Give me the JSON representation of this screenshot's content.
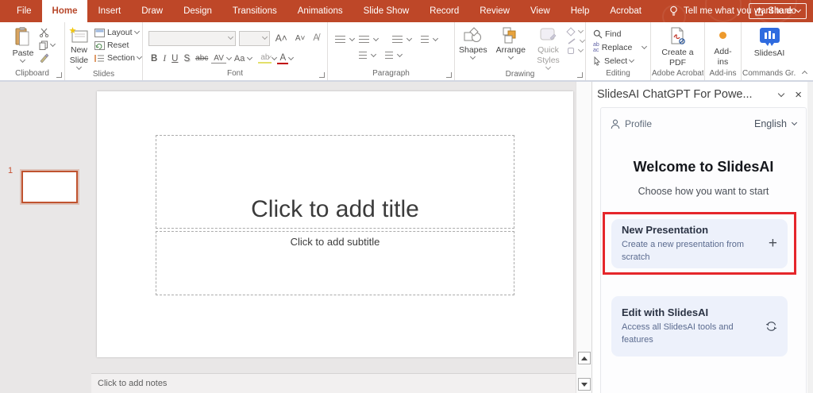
{
  "titlebar": {
    "tabs": [
      "File",
      "Home",
      "Insert",
      "Draw",
      "Design",
      "Transitions",
      "Animations",
      "Slide Show",
      "Record",
      "Review",
      "View",
      "Help",
      "Acrobat"
    ],
    "active_tab": "Home",
    "tell_me": "Tell me what you want to do",
    "share": "Share"
  },
  "ribbon": {
    "paste": "Paste",
    "new_slide": "New Slide",
    "layout": "Layout",
    "reset": "Reset",
    "section": "Section",
    "font_buttons": {
      "bold": "B",
      "italic": "I",
      "underline": "U",
      "shadow": "S",
      "strike": "abc",
      "spacing": "AV",
      "case": "Aa",
      "color": "A"
    },
    "shapes": "Shapes",
    "arrange": "Arrange",
    "quick_styles": "Quick Styles",
    "find": "Find",
    "replace": "Replace",
    "select": "Select",
    "create_pdf": "Create a PDF",
    "addins": "Add-ins",
    "slidesai": "SlidesAI",
    "group_labels": {
      "clipboard": "Clipboard",
      "slides": "Slides",
      "font": "Font",
      "paragraph": "Paragraph",
      "drawing": "Drawing",
      "editing": "Editing",
      "acrobat": "Adobe Acrobat",
      "addins": "Add-ins",
      "commands": "Commands Gr..."
    }
  },
  "thumbnails": {
    "slide_number": "1"
  },
  "editor": {
    "title_placeholder": "Click to add title",
    "subtitle_placeholder": "Click to add subtitle"
  },
  "notes": {
    "placeholder": "Click to add notes"
  },
  "panel": {
    "title": "SlidesAI ChatGPT For Powe...",
    "profile": "Profile",
    "language": "English",
    "welcome_title": "Welcome to SlidesAI",
    "welcome_subtitle": "Choose how you want to start",
    "cards": [
      {
        "title": "New Presentation",
        "description": "Create a new presentation from scratch"
      },
      {
        "title": "Edit with SlidesAI",
        "description": "Access all SlidesAI tools and features"
      }
    ]
  },
  "icons": {
    "close": "×",
    "plus": "+"
  },
  "colors": {
    "titlebar": "#BE4728",
    "accent_red": "#E5262B",
    "card_bg": "#EDF1FB",
    "thumb_border": "#C0532F",
    "slidesai_blue": "#2F6BDF",
    "addins_dot": "#ED9A2D"
  }
}
